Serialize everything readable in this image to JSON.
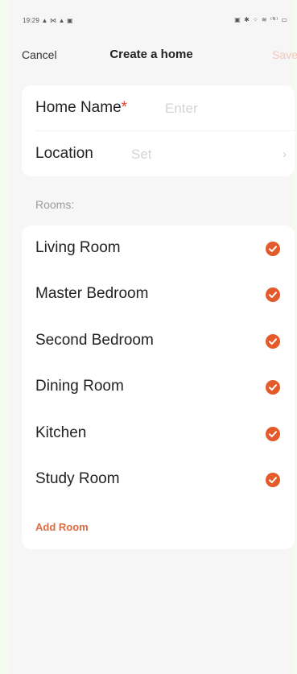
{
  "status_bar": {
    "time": "19:29 ▲ ⋈ ▲ ▣",
    "right_icons": "▣ ✱ ⁘ ≋ ⁽ᴺ⁾ ▭"
  },
  "nav": {
    "cancel_label": "Cancel",
    "title": "Create a home",
    "save_label": "Save"
  },
  "form": {
    "home_name_label": "Home Name",
    "required_mark": "*",
    "home_name_placeholder": "Enter",
    "location_label": "Location",
    "location_value": "Set",
    "location_chevron": "›"
  },
  "rooms": {
    "heading": "Rooms:",
    "items": [
      {
        "label": "Living Room",
        "checked": true
      },
      {
        "label": "Master Bedroom",
        "checked": true
      },
      {
        "label": "Second Bedroom",
        "checked": true
      },
      {
        "label": "Dining Room",
        "checked": true
      },
      {
        "label": "Kitchen",
        "checked": true
      },
      {
        "label": "Study Room",
        "checked": true
      }
    ],
    "add_room_label": "Add Room"
  },
  "colors": {
    "accent": "#e35a2b",
    "save_disabled": "#f7c4bb",
    "background": "#f6f6f7"
  },
  "icons": {
    "check": "check-circle-icon",
    "chevron": "chevron-right-icon"
  }
}
